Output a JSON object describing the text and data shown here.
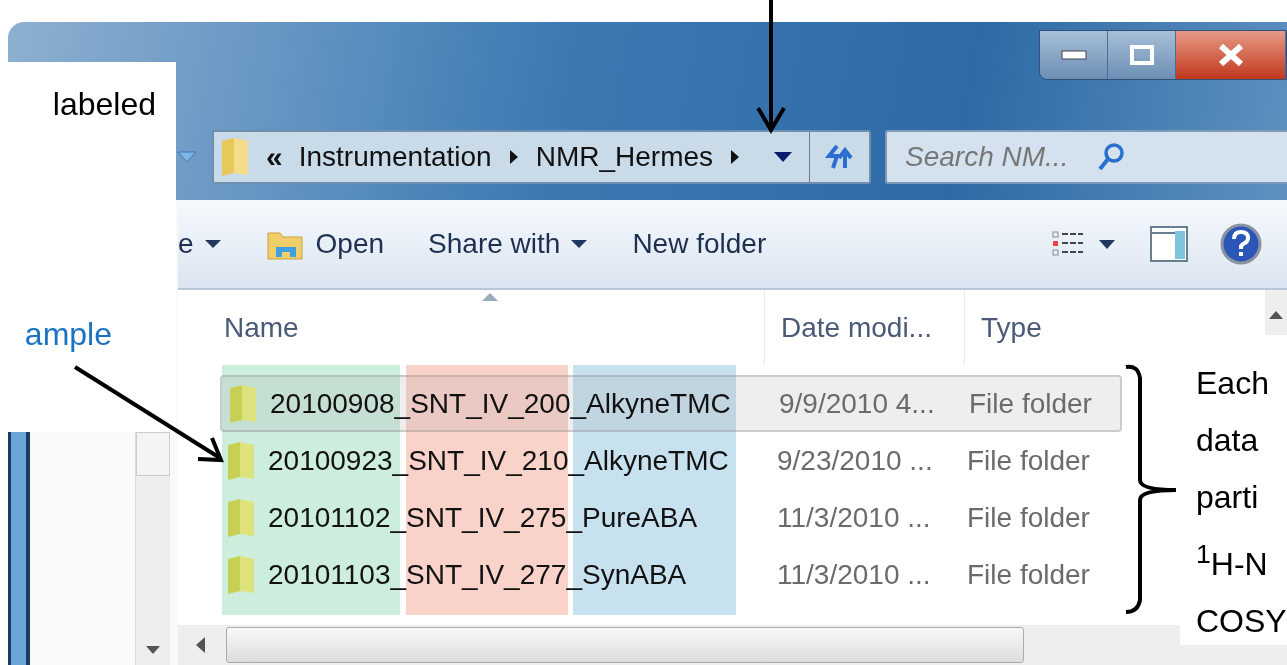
{
  "address": {
    "overflow": "«",
    "path": [
      "Instrumentation",
      "NMR_Hermes"
    ]
  },
  "search": {
    "placeholder": "Search NM..."
  },
  "toolbar": [
    {
      "label": "e",
      "kind": "menu"
    },
    {
      "label": "Open",
      "kind": "open"
    },
    {
      "label": "Share with",
      "kind": "menu"
    },
    {
      "label": "New folder",
      "kind": "plain"
    }
  ],
  "columns": [
    {
      "label": "Name",
      "sorted": true
    },
    {
      "label": "Date modi...",
      "sorted": false
    },
    {
      "label": "Type",
      "sorted": false
    }
  ],
  "rows": [
    {
      "name": "20100908_SNT_IV_200_AlkyneTMC",
      "date": "9/9/2010 4...",
      "type": "File folder",
      "selected": true
    },
    {
      "name": "20100923_SNT_IV_210_AlkyneTMC",
      "date": "9/23/2010 ...",
      "type": "File folder",
      "selected": false
    },
    {
      "name": "20101102_SNT_IV_275_PureABA",
      "date": "11/3/2010 ...",
      "type": "File folder",
      "selected": false
    },
    {
      "name": "20101103_SNT_IV_277_SynABA",
      "date": "11/3/2010 ...",
      "type": "File folder",
      "selected": false
    }
  ],
  "highlights": [
    {
      "color": "#cdeedd"
    },
    {
      "color": "#f9d2ca"
    },
    {
      "color": "#c8e1ef"
    }
  ],
  "left_callout": [
    {
      "kind": "plain",
      "text": "labeled"
    },
    {
      "kind": "accent",
      "text": "ample"
    }
  ],
  "right_callout": [
    "Each",
    "data",
    "parti",
    "$^{1}$H-N",
    "COSY"
  ]
}
